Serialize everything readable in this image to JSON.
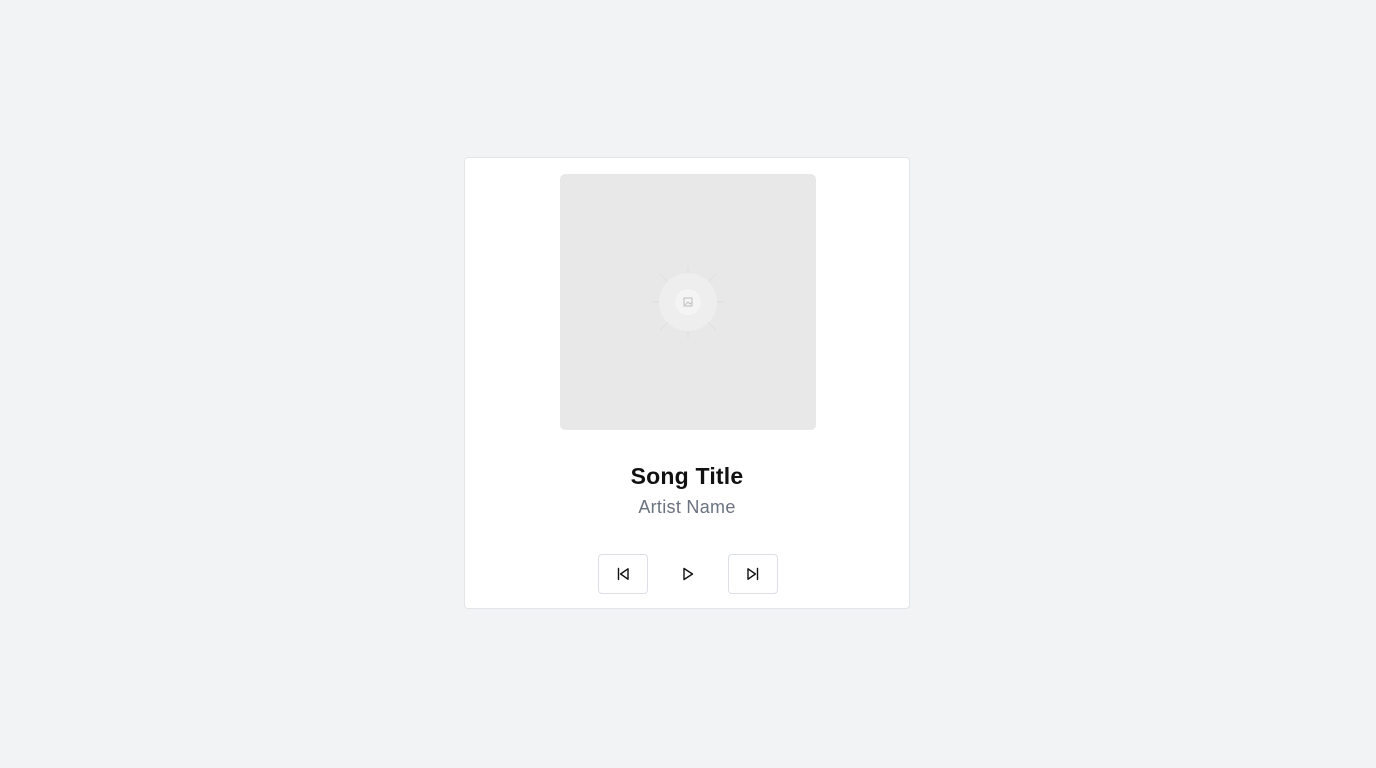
{
  "player": {
    "song_title": "Song Title",
    "artist_name": "Artist Name"
  },
  "controls": {
    "previous_icon": "skip-back-icon",
    "play_icon": "play-icon",
    "next_icon": "skip-forward-icon"
  },
  "cover": {
    "icon": "image-placeholder-icon"
  },
  "colors": {
    "background": "#f2f3f5",
    "card": "#ffffff",
    "cover": "#e8e8e8",
    "title": "#111111",
    "artist": "#6b7280"
  }
}
